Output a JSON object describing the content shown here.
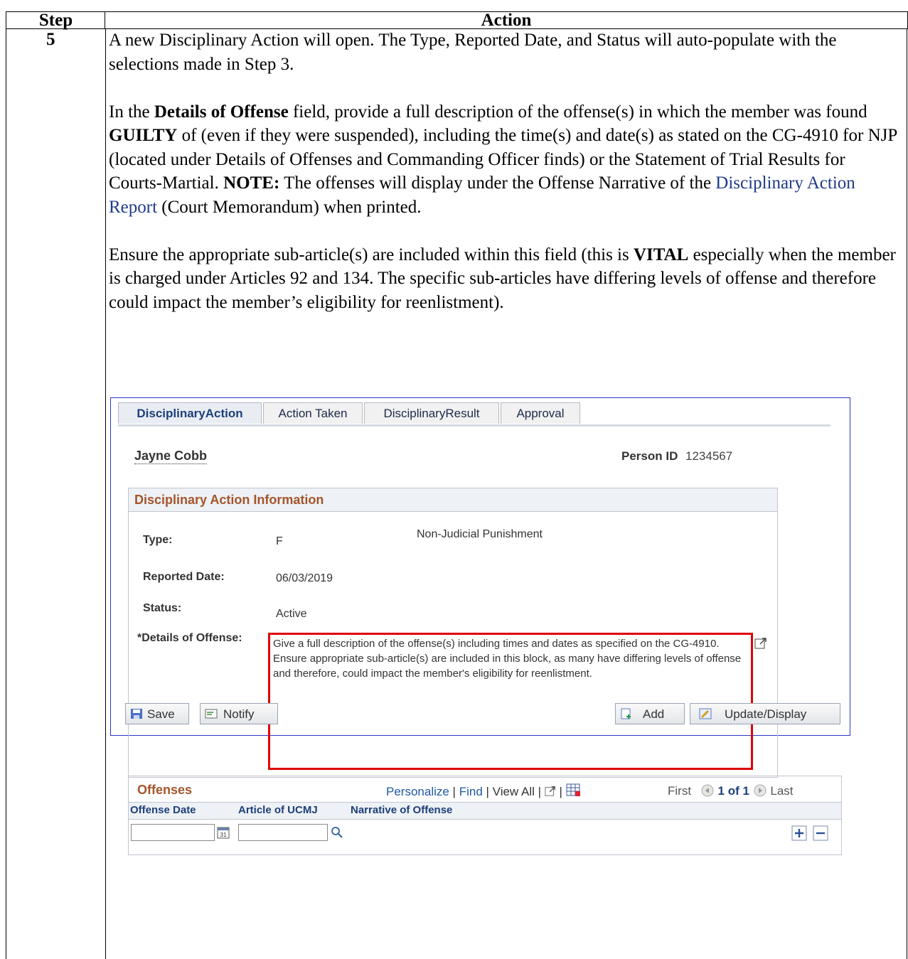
{
  "doc": {
    "header_step": "Step",
    "header_action": "Action",
    "step_number": "5",
    "p1": "A new Disciplinary Action will open. The Type, Reported Date, and Status will auto-populate with the selections made in Step 3.",
    "p2_a": "In the ",
    "p2_b": "Details of Offense",
    "p2_c": " field, provide a full description of the offense(s) in which the member was found ",
    "p2_d": "GUILTY",
    "p2_e": " of (even if they were suspended), including the time(s) and date(s) as stated on the CG-4910 for NJP (located under Details of Offenses and Commanding Officer finds) or the Statement of Trial Results for Courts-Martial. ",
    "p2_f": "NOTE:",
    "p2_g": " The offenses will display under the Offense Narrative of the ",
    "p2_h": "Disciplinary Action Report",
    "p2_i": " (Court Memorandum) when printed.",
    "p3_a": "Ensure the appropriate sub-article(s) are included within this field (this is ",
    "p3_b": "VITAL",
    "p3_c": " especially when the member is charged under Articles 92 and 134. The specific sub-articles have differing levels of offense and therefore could impact the member’s eligibility for reenlistment)."
  },
  "app": {
    "tabs": [
      "DisciplinaryAction",
      "Action Taken",
      "DisciplinaryResult",
      "Approval"
    ],
    "person_name": "Jayne Cobb",
    "person_id_label": "Person ID",
    "person_id": "1234567",
    "section_title": "Disciplinary Action Information",
    "type_label": "Type:",
    "type_code": "F",
    "type_desc": "Non-Judicial Punishment",
    "reported_label": "Reported Date:",
    "reported_value": "06/03/2019",
    "status_label": "Status:",
    "status_value": "Active",
    "details_label": "*Details of Offense:",
    "details_value": "Give a full description of the offense(s) including times and dates as specified on the CG-4910.  Ensure appropriate sub-article(s) are included in this block, as many have differing levels of offense and therefore, could impact the member's eligibility for reenlistment.",
    "offenses": {
      "title": "Offenses",
      "personalize": "Personalize",
      "find": "Find",
      "view_all": "View All",
      "first": "First",
      "range": "1 of 1",
      "last": "Last",
      "col_date": "Offense Date",
      "col_article": "Article of UCMJ",
      "col_narrative": "Narrative of Offense"
    },
    "buttons": {
      "save": "Save",
      "notify": "Notify",
      "add": "Add",
      "update": "Update/Display"
    }
  }
}
